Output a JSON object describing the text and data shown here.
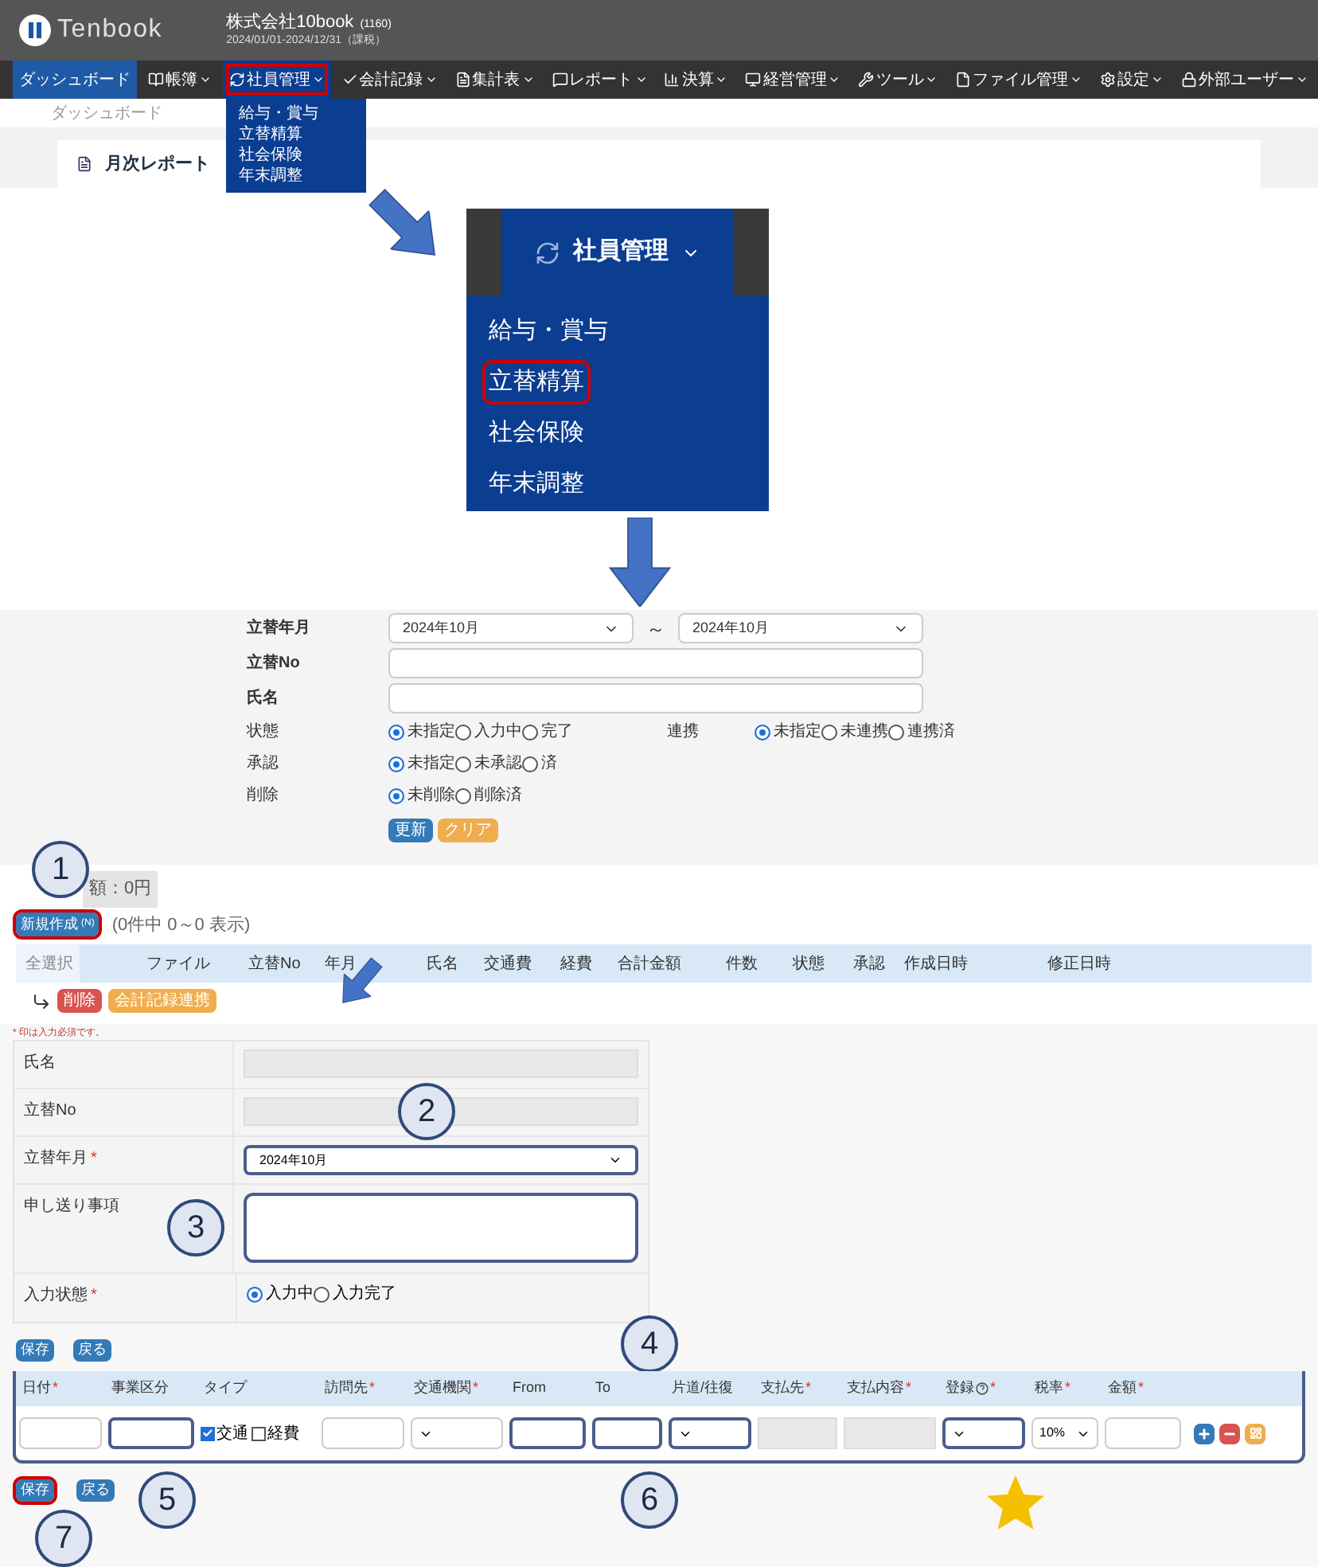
{
  "app_header": {
    "logo": "Tenbook",
    "company": "株式会社10book",
    "company_code": "(1160)",
    "period": "2024/01/01-2024/12/31（課税）"
  },
  "nav": [
    {
      "label": "ダッシュボード",
      "selected": true,
      "highlighted": false,
      "dropdown": false
    },
    {
      "label": "帳簿",
      "selected": false,
      "highlighted": false,
      "dropdown": true
    },
    {
      "label": "社員管理",
      "selected": false,
      "highlighted": true,
      "dropdown": true
    },
    {
      "label": "会計記録",
      "selected": false,
      "highlighted": false,
      "dropdown": true
    },
    {
      "label": "集計表",
      "selected": false,
      "highlighted": false,
      "dropdown": true
    },
    {
      "label": "レポート",
      "selected": false,
      "highlighted": false,
      "dropdown": true
    },
    {
      "label": "決算",
      "selected": false,
      "highlighted": false,
      "dropdown": true
    },
    {
      "label": "経営管理",
      "selected": false,
      "highlighted": false,
      "dropdown": true
    },
    {
      "label": "ツール",
      "selected": false,
      "highlighted": false,
      "dropdown": true
    },
    {
      "label": "ファイル管理",
      "selected": false,
      "highlighted": false,
      "dropdown": true
    },
    {
      "label": "設定",
      "selected": false,
      "highlighted": false,
      "dropdown": true
    },
    {
      "label": "外部ユーザー",
      "selected": false,
      "highlighted": false,
      "dropdown": true
    }
  ],
  "dropdown_menu": [
    "給与・賞与",
    "立替精算",
    "社会保険",
    "年末調整"
  ],
  "breadcrumb": "ダッシュボード",
  "card_title": "月次レポート",
  "zoomed_menu": {
    "title": "社員管理",
    "items": [
      {
        "label": "給与・賞与",
        "highlighted": false
      },
      {
        "label": "立替精算",
        "highlighted": true
      },
      {
        "label": "社会保険",
        "highlighted": false
      },
      {
        "label": "年末調整",
        "highlighted": false
      }
    ]
  },
  "filter": {
    "period": {
      "label": "立替年月",
      "from": "2024年10月",
      "separator": "～",
      "to": "2024年10月"
    },
    "number": {
      "label": "立替No"
    },
    "name": {
      "label": "氏名"
    },
    "radios": [
      {
        "label": "状態",
        "options": [
          {
            "label": "未指定",
            "selected": true
          },
          {
            "label": "入力中",
            "selected": false
          },
          {
            "label": "完了",
            "selected": false
          }
        ],
        "extra": {
          "label": "連携",
          "options": [
            {
              "label": "未指定",
              "selected": true
            },
            {
              "label": "未連携",
              "selected": false
            },
            {
              "label": "連携済",
              "selected": false
            }
          ]
        }
      },
      {
        "label": "承認",
        "options": [
          {
            "label": "未指定",
            "selected": true
          },
          {
            "label": "未承認",
            "selected": false
          },
          {
            "label": "済",
            "selected": false
          }
        ]
      },
      {
        "label": "削除",
        "options": [
          {
            "label": "未削除",
            "selected": true
          },
          {
            "label": "削除済",
            "selected": false
          }
        ]
      }
    ],
    "buttons": [
      {
        "label": "更新",
        "kind": "primary"
      },
      {
        "label": "クリア",
        "kind": "warning"
      }
    ]
  },
  "list": {
    "summary": "額：0円",
    "new_button": {
      "label": "新規作成",
      "shortcut": "(N)",
      "highlighted": true
    },
    "count": "(0件中 0～0 表示)",
    "columns": [
      "全選択",
      "",
      "ファイル",
      "立替No",
      "年月",
      "氏名",
      "交通費",
      "経費",
      "合計金額",
      "件数",
      "状態",
      "承認",
      "作成日時",
      "修正日時"
    ],
    "actions": [
      {
        "label": "削除",
        "kind": "danger"
      },
      {
        "label": "会計記録連携",
        "kind": "warning"
      }
    ]
  },
  "edit_form": {
    "note": "* 印は入力必須です。",
    "rows": [
      {
        "label": "氏名",
        "kind": "disabled"
      },
      {
        "label": "立替No",
        "kind": "disabled"
      },
      {
        "label": "立替年月",
        "required": "*",
        "kind": "select",
        "value": "2024年10月"
      },
      {
        "label": "申し送り事項",
        "kind": "textarea"
      },
      {
        "label": "入力状態",
        "required": "*",
        "kind": "radio",
        "options": [
          {
            "label": "入力中",
            "selected": true
          },
          {
            "label": "入力完了",
            "selected": false
          }
        ]
      }
    ],
    "buttons": [
      "保存",
      "戻る"
    ]
  },
  "detail_table": {
    "columns": [
      {
        "label": "日付",
        "required": "*",
        "kind": "input"
      },
      {
        "label": "事業区分",
        "kind": "input"
      },
      {
        "label": "タイプ",
        "kind": "checks",
        "options": [
          {
            "label": "交通",
            "checked": true
          },
          {
            "label": "経費",
            "checked": false
          }
        ]
      },
      {
        "label": "訪問先",
        "required": "*",
        "kind": "input"
      },
      {
        "label": "交通機関",
        "required": "*",
        "kind": "select"
      },
      {
        "label": "From",
        "kind": "input"
      },
      {
        "label": "To",
        "kind": "input"
      },
      {
        "label": "片道/往復",
        "kind": "select"
      },
      {
        "label": "支払先",
        "required": "*",
        "kind": "disabled"
      },
      {
        "label": "支払内容",
        "required": "*",
        "kind": "disabled"
      },
      {
        "label": "登録",
        "required": "*",
        "help": true,
        "kind": "select"
      },
      {
        "label": "税率",
        "required": "*",
        "kind": "select",
        "value": "10%"
      },
      {
        "label": "金額",
        "required": "*",
        "kind": "input"
      }
    ],
    "bottom_buttons": [
      {
        "label": "保存",
        "highlighted": true
      },
      {
        "label": "戻る",
        "highlighted": false
      }
    ]
  },
  "callouts": [
    "1",
    "2",
    "3",
    "4",
    "5",
    "6",
    "7"
  ]
}
